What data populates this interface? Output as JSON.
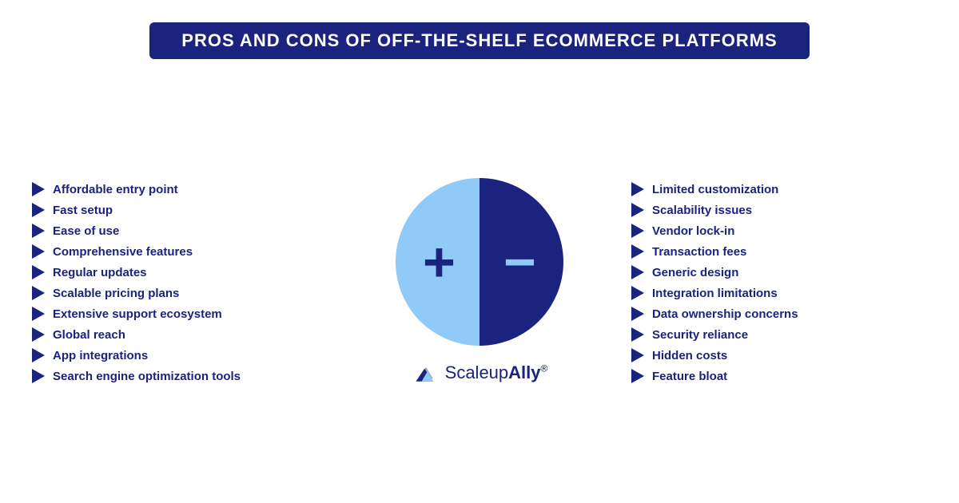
{
  "title": "PROS AND CONS OF OFF-THE-SHELF ECOMMERCE PLATFORMS",
  "pros": [
    "Affordable entry point",
    "Fast setup",
    "Ease of use",
    "Comprehensive features",
    "Regular updates",
    "Scalable pricing plans",
    "Extensive support ecosystem",
    "Global reach",
    "App integrations",
    "Search engine optimization tools"
  ],
  "cons": [
    "Limited customization",
    "Scalability issues",
    "Vendor lock-in",
    "Transaction fees",
    "Generic design",
    "Integration limitations",
    "Data ownership concerns",
    "Security reliance",
    "Hidden costs",
    "Feature bloat"
  ],
  "center": {
    "plus": "+",
    "minus": "−"
  },
  "logo": {
    "text_normal": "Scaleup",
    "text_bold": "Ally",
    "registered": "®"
  }
}
